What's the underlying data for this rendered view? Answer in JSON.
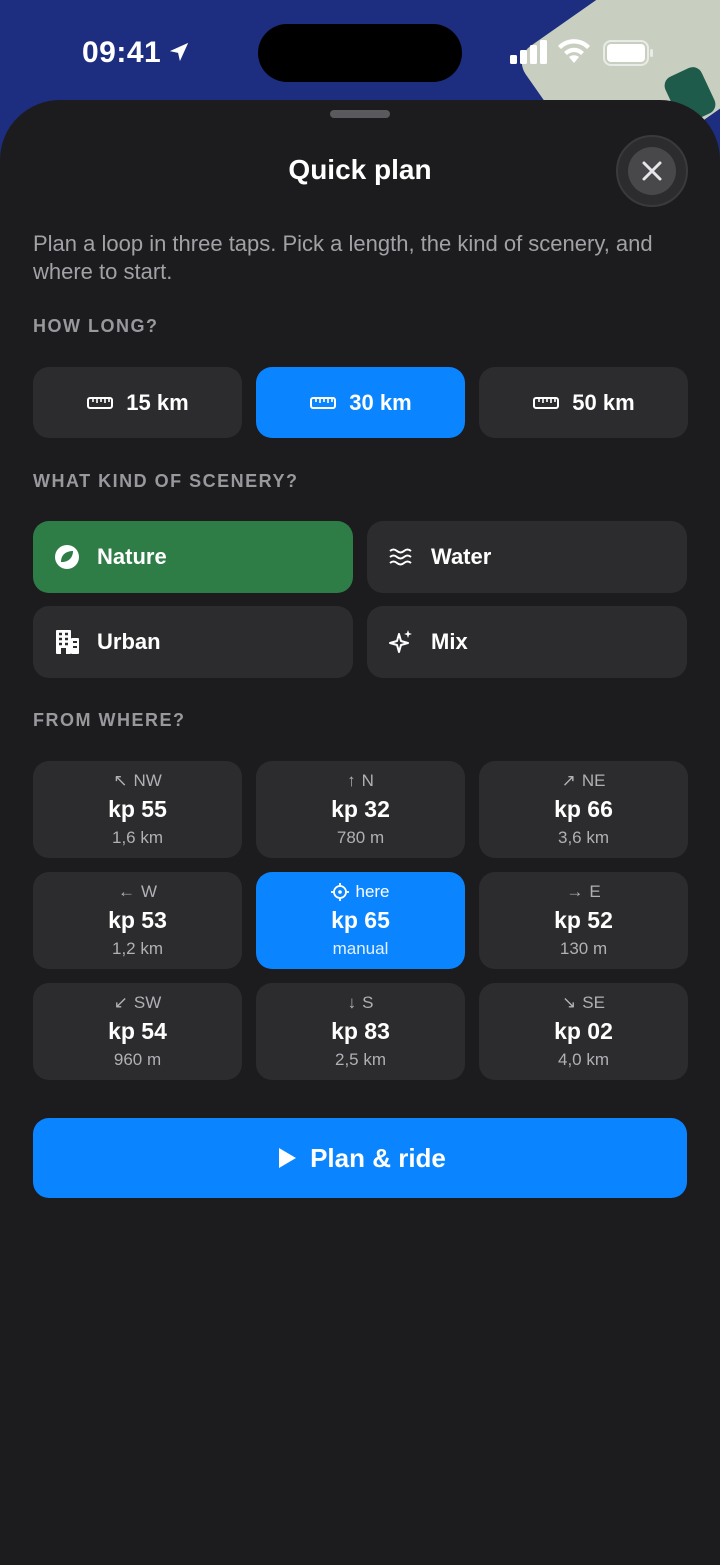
{
  "status": {
    "time": "09:41"
  },
  "sheet": {
    "title": "Quick plan",
    "description": "Plan a loop in three taps. Pick a length, the kind of scenery, and where to start."
  },
  "length": {
    "label": "HOW LONG?",
    "options": [
      {
        "label": "15 km",
        "selected": false
      },
      {
        "label": "30 km",
        "selected": true
      },
      {
        "label": "50 km",
        "selected": false
      }
    ]
  },
  "scenery": {
    "label": "WHAT KIND OF SCENERY?",
    "options": [
      {
        "label": "Nature",
        "icon": "leaf-icon",
        "selected": true
      },
      {
        "label": "Water",
        "icon": "waves-icon",
        "selected": false
      },
      {
        "label": "Urban",
        "icon": "building-icon",
        "selected": false
      },
      {
        "label": "Mix",
        "icon": "sparkles-icon",
        "selected": false
      }
    ]
  },
  "start": {
    "label": "FROM WHERE?",
    "cells": [
      {
        "dir": "NW",
        "arrow": "↖",
        "name": "kp 55",
        "dist": "1,6 km"
      },
      {
        "dir": "N",
        "arrow": "↑",
        "name": "kp 32",
        "dist": "780 m"
      },
      {
        "dir": "NE",
        "arrow": "↗",
        "name": "kp 66",
        "dist": "3,6 km"
      },
      {
        "dir": "W",
        "arrow": "←",
        "name": "kp 53",
        "dist": "1,2 km"
      },
      {
        "dir": "here",
        "arrow": "⌖",
        "name": "kp 65",
        "dist": "manual",
        "selected": true
      },
      {
        "dir": "E",
        "arrow": "→",
        "name": "kp 52",
        "dist": "130 m"
      },
      {
        "dir": "SW",
        "arrow": "↙",
        "name": "kp 54",
        "dist": "960 m"
      },
      {
        "dir": "S",
        "arrow": "↓",
        "name": "kp 83",
        "dist": "2,5 km"
      },
      {
        "dir": "SE",
        "arrow": "↘",
        "name": "kp 02",
        "dist": "4,0 km"
      }
    ]
  },
  "action": {
    "label": "Plan & ride"
  },
  "colors": {
    "accent": "#0a84ff",
    "nature": "#2e7d47",
    "sheet": "#1c1c1e",
    "chip": "#2c2c2e"
  }
}
